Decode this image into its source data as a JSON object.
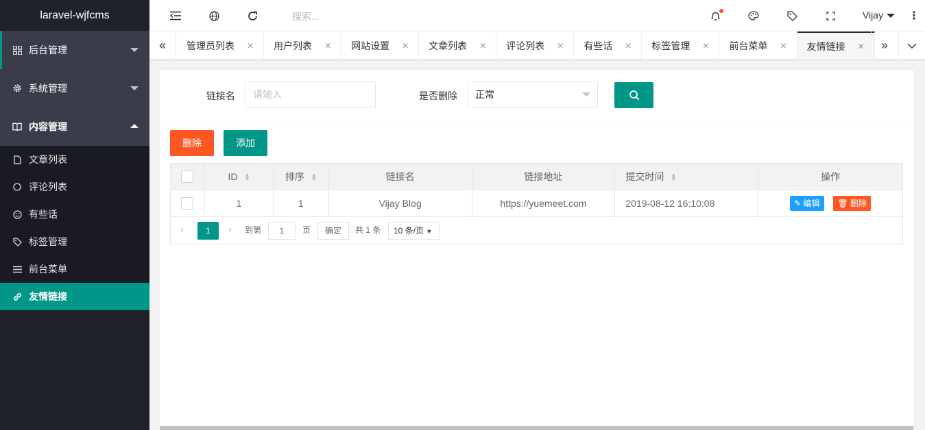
{
  "sidebar": {
    "logo": "laravel-wjfcms",
    "groups": [
      {
        "label": "后台管理",
        "icon": "grid-icon"
      },
      {
        "label": "系统管理",
        "icon": "gear-icon"
      },
      {
        "label": "内容管理",
        "icon": "book-icon"
      }
    ],
    "subitems": [
      {
        "label": "文章列表",
        "icon": "document-icon"
      },
      {
        "label": "评论列表",
        "icon": "chat-icon"
      },
      {
        "label": "有些话",
        "icon": "smile-icon"
      },
      {
        "label": "标签管理",
        "icon": "tag-icon"
      },
      {
        "label": "前台菜单",
        "icon": "sliders-icon"
      },
      {
        "label": "友情链接",
        "icon": "link-icon"
      }
    ]
  },
  "header": {
    "search_placeholder": "搜索...",
    "user": "Vijay"
  },
  "tabs": [
    "管理员列表",
    "用户列表",
    "网站设置",
    "文章列表",
    "评论列表",
    "有些话",
    "标签管理",
    "前台菜单",
    "友情链接"
  ],
  "filter": {
    "name_label": "链接名",
    "name_placeholder": "请输入",
    "deleted_label": "是否删除",
    "deleted_value": "正常"
  },
  "toolbar": {
    "delete_label": "删除",
    "add_label": "添加"
  },
  "table": {
    "headers": [
      "ID",
      "排序",
      "链接名",
      "链接地址",
      "提交时间",
      "操作"
    ],
    "rows": [
      {
        "id": "1",
        "sort": "1",
        "name": "Vijay Blog",
        "url": "https://yuemeet.com",
        "time": "2019-08-12 16:10:08",
        "edit": "编辑",
        "del": "删除"
      }
    ]
  },
  "pager": {
    "current": "1",
    "goto_label": "到第",
    "page_value": "1",
    "page_unit": "页",
    "confirm": "确定",
    "total": "共 1 条",
    "per_page": "10 条/页"
  },
  "colors": {
    "accent": "#009688",
    "danger": "#ff5722",
    "info": "#1e9fff",
    "sidebar": "#20222a"
  }
}
